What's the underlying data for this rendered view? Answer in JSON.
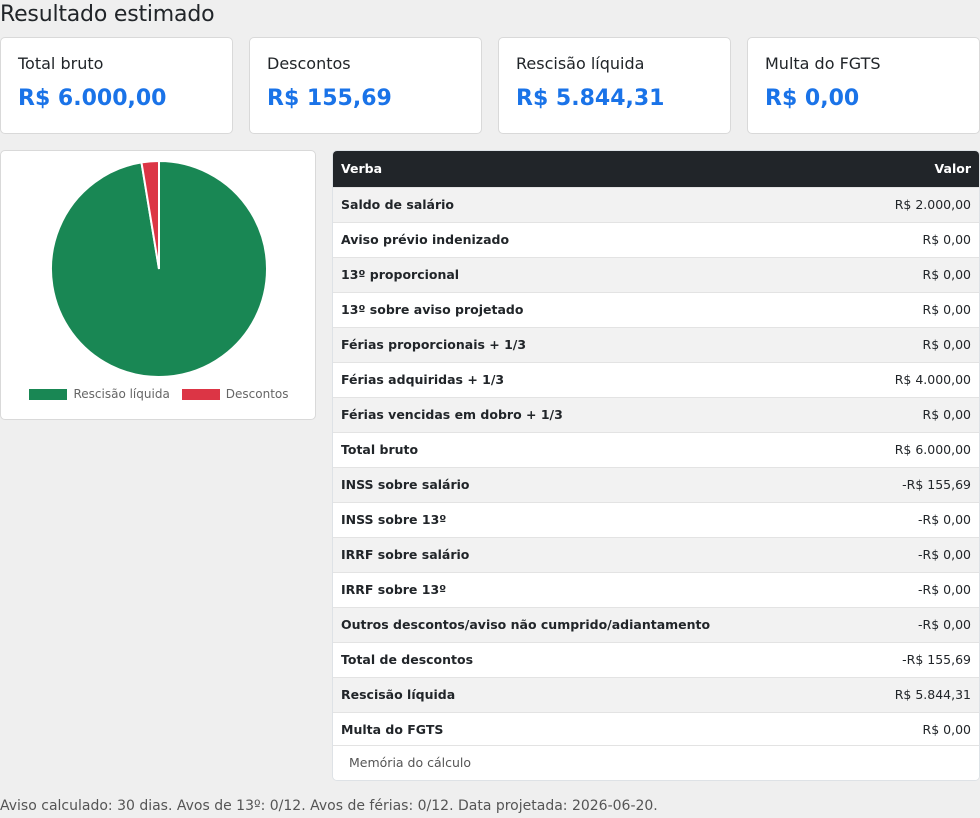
{
  "page": {
    "title": "Resultado estimado"
  },
  "cards": [
    {
      "label": "Total bruto",
      "value": "R$ 6.000,00"
    },
    {
      "label": "Descontos",
      "value": "R$ 155,69"
    },
    {
      "label": "Rescisão líquida",
      "value": "R$ 5.844,31"
    },
    {
      "label": "Multa do FGTS",
      "value": "R$ 0,00"
    }
  ],
  "chart_data": {
    "type": "pie",
    "categories": [
      "Rescisão líquida",
      "Descontos"
    ],
    "values": [
      5844.31,
      155.69
    ],
    "colors": [
      "#198754",
      "#dc3545"
    ],
    "legend": "bottom"
  },
  "table": {
    "headers": {
      "item": "Verba",
      "value": "Valor"
    },
    "rows": [
      {
        "item": "Saldo de salário",
        "value": "R$ 2.000,00"
      },
      {
        "item": "Aviso prévio indenizado",
        "value": "R$ 0,00"
      },
      {
        "item": "13º proporcional",
        "value": "R$ 0,00"
      },
      {
        "item": "13º sobre aviso projetado",
        "value": "R$ 0,00"
      },
      {
        "item": "Férias proporcionais + 1/3",
        "value": "R$ 0,00"
      },
      {
        "item": "Férias adquiridas + 1/3",
        "value": "R$ 4.000,00"
      },
      {
        "item": "Férias vencidas em dobro + 1/3",
        "value": "R$ 0,00"
      },
      {
        "item": "Total bruto",
        "value": "R$ 6.000,00"
      },
      {
        "item": "INSS sobre salário",
        "value": "-R$ 155,69"
      },
      {
        "item": "INSS sobre 13º",
        "value": "-R$ 0,00"
      },
      {
        "item": "IRRF sobre salário",
        "value": "-R$ 0,00"
      },
      {
        "item": "IRRF sobre 13º",
        "value": "-R$ 0,00"
      },
      {
        "item": "Outros descontos/aviso não cumprido/adiantamento",
        "value": "-R$ 0,00"
      },
      {
        "item": "Total de descontos",
        "value": "-R$ 155,69"
      },
      {
        "item": "Rescisão líquida",
        "value": "R$ 5.844,31"
      },
      {
        "item": "Multa do FGTS",
        "value": "R$ 0,00"
      }
    ],
    "memo_label": "Memória do cálculo"
  },
  "footer": {
    "text": "Aviso calculado: 30 dias. Avos de 13º: 0/12. Avos de férias: 0/12. Data projetada: 2026-06-20."
  }
}
